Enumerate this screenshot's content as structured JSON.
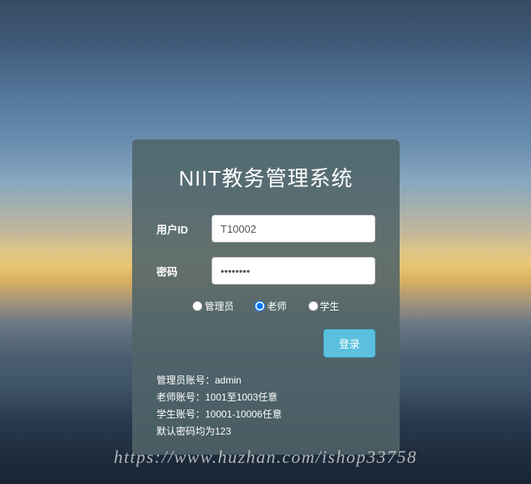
{
  "title": "NIIT教务管理系统",
  "fields": {
    "userid": {
      "label": "用户ID",
      "value": "T10002",
      "placeholder": ""
    },
    "password": {
      "label": "密码",
      "value": "••••••••",
      "placeholder": ""
    }
  },
  "roles": {
    "admin": "管理员",
    "teacher": "老师",
    "student": "学生",
    "selected": "teacher"
  },
  "login_button": "登录",
  "hints": {
    "admin": "管理员账号：admin",
    "teacher": "老师账号：1001至1003任意",
    "student": "学生账号：10001-10006任意",
    "default_pw": "默认密码均为123"
  },
  "watermark": "https://www.huzhan.com/ishop33758"
}
